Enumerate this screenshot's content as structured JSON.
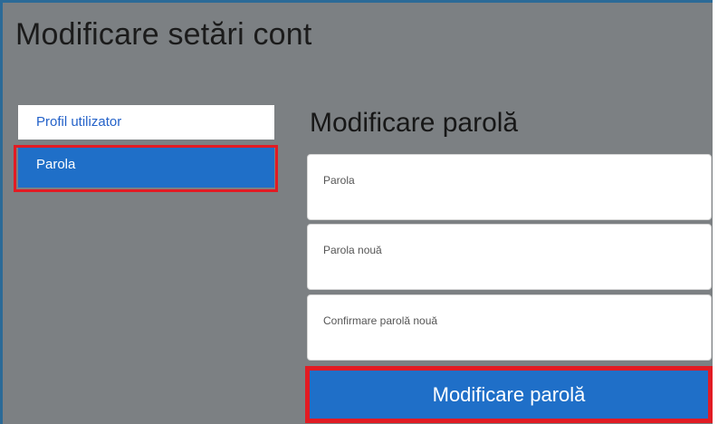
{
  "header": {
    "title": "Modificare setări cont"
  },
  "sidebar": {
    "items": [
      {
        "label": "Profil utilizator"
      },
      {
        "label": "Parola"
      }
    ]
  },
  "main": {
    "title": "Modificare parolă",
    "fields": [
      {
        "placeholder": "Parola"
      },
      {
        "placeholder": "Parola nouă"
      },
      {
        "placeholder": "Confirmare parolă nouă"
      }
    ],
    "submit_label": "Modificare parolă"
  },
  "colors": {
    "background": "#7c8083",
    "accent": "#1f6fc8",
    "highlight": "#e21b23",
    "link": "#2462c9"
  }
}
